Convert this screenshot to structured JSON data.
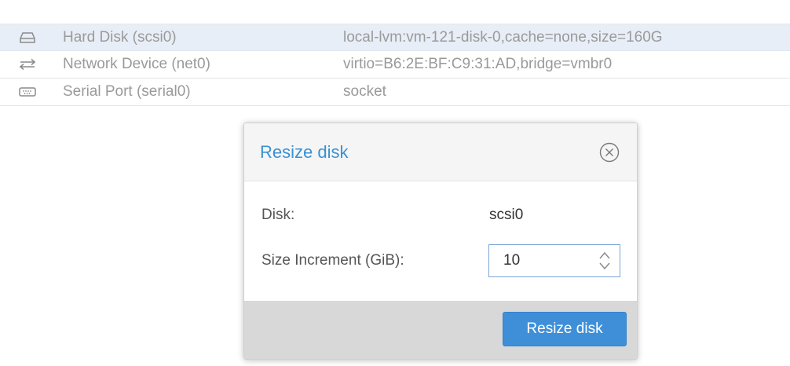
{
  "hardware_list": {
    "rows": [
      {
        "icon": "hard-disk-icon",
        "name": "Hard Disk (scsi0)",
        "value": "local-lvm:vm-121-disk-0,cache=none,size=160G",
        "selected": true
      },
      {
        "icon": "network-device-icon",
        "name": "Network Device (net0)",
        "value": "virtio=B6:2E:BF:C9:31:AD,bridge=vmbr0",
        "selected": false
      },
      {
        "icon": "serial-port-icon",
        "name": "Serial Port (serial0)",
        "value": "socket",
        "selected": false
      }
    ]
  },
  "dialog": {
    "title": "Resize disk",
    "close_icon": "close-circle-icon",
    "disk_label": "Disk:",
    "disk_value": "scsi0",
    "size_label": "Size Increment (GiB):",
    "size_value": "10",
    "submit_label": "Resize disk"
  },
  "colors": {
    "accent": "#3892d4",
    "button": "#3e8fd8",
    "selected_row": "#e8eef7",
    "footer": "#d8d8d8"
  }
}
